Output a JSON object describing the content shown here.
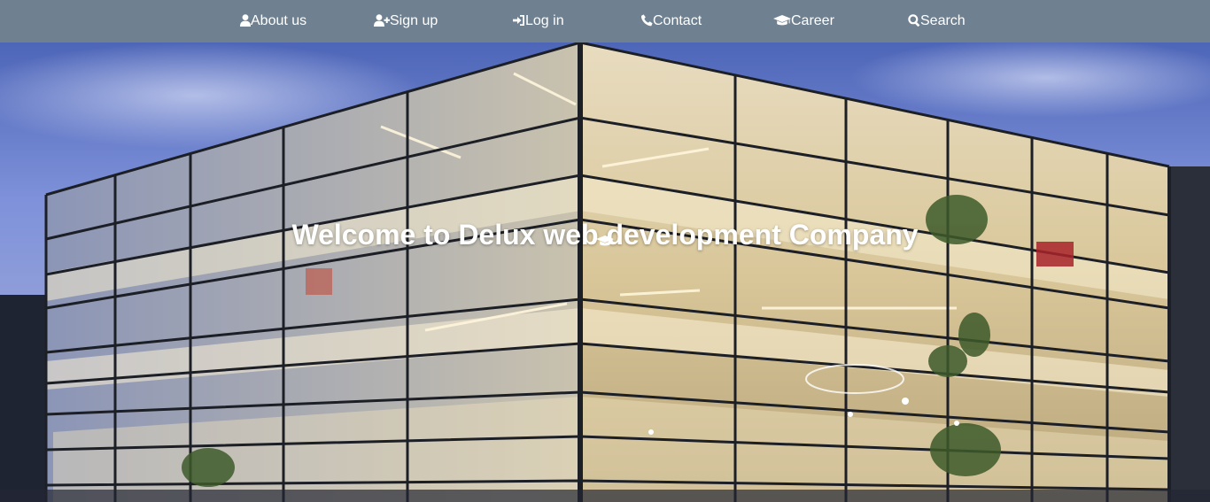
{
  "nav": {
    "items": [
      {
        "label": "About us",
        "icon": "user-icon"
      },
      {
        "label": "Sign up",
        "icon": "user-plus-icon"
      },
      {
        "label": "Log in",
        "icon": "sign-in-icon"
      },
      {
        "label": "Contact",
        "icon": "phone-icon"
      },
      {
        "label": "Career",
        "icon": "graduation-cap-icon"
      },
      {
        "label": "Search",
        "icon": "search-icon"
      }
    ],
    "background": "#6f8190"
  },
  "hero": {
    "title": "Welcome to Delux web development Company",
    "icon": "graduation-cap-icon",
    "image": "glass office building at dusk"
  }
}
